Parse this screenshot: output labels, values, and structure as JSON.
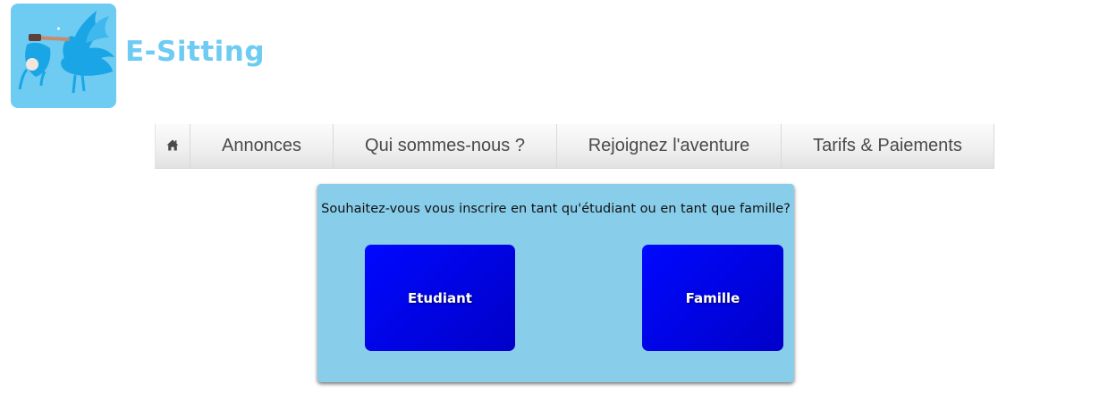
{
  "brand": {
    "name": "E-Sitting",
    "logo_icon": "stork-carrying-baby-icon",
    "color": "#6ecbf2"
  },
  "nav": {
    "home_icon": "home-icon",
    "items": [
      {
        "label": "Annonces"
      },
      {
        "label": "Qui sommes-nous ?"
      },
      {
        "label": "Rejoignez l'aventure"
      },
      {
        "label": "Tarifs & Paiements"
      }
    ]
  },
  "signup_choice": {
    "question": "Souhaitez-vous vous inscrire en tant qu'étudiant ou en tant que famille?",
    "student_label": "Etudiant",
    "family_label": "Famille",
    "panel_color": "#88ceea",
    "button_color": "#0008ff"
  }
}
